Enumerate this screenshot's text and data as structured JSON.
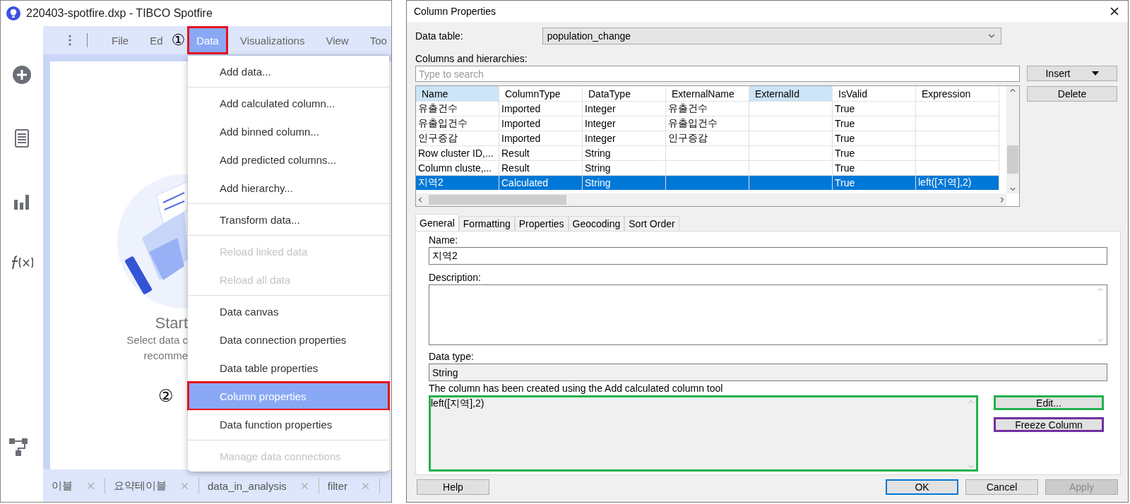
{
  "left_window": {
    "title": "220403-spotfire.dxp - TIBCO Spotfire",
    "menubar": [
      {
        "label": "File",
        "selected": false,
        "highlighted": false
      },
      {
        "label": "Ed",
        "selected": false,
        "highlighted": false
      },
      {
        "label": "Data",
        "selected": true,
        "highlighted": true,
        "marker": "①"
      },
      {
        "label": "Visualizations",
        "selected": false,
        "highlighted": false
      },
      {
        "label": "View",
        "selected": false,
        "highlighted": false
      },
      {
        "label": "Too",
        "selected": false,
        "highlighted": false
      }
    ],
    "start_title": "Start",
    "start_lines": [
      "Select data c",
      "recomme"
    ],
    "menu": {
      "groups": [
        [
          {
            "label": "Add data...",
            "disabled": false,
            "selected": false,
            "highlighted": false
          }
        ],
        [
          {
            "label": "Add calculated column...",
            "disabled": false,
            "selected": false,
            "highlighted": false
          },
          {
            "label": "Add binned column...",
            "disabled": false,
            "selected": false,
            "highlighted": false
          },
          {
            "label": "Add predicted columns...",
            "disabled": false,
            "selected": false,
            "highlighted": false
          },
          {
            "label": "Add hierarchy...",
            "disabled": false,
            "selected": false,
            "highlighted": false
          }
        ],
        [
          {
            "label": "Transform data...",
            "disabled": false,
            "selected": false,
            "highlighted": false
          }
        ],
        [
          {
            "label": "Reload linked data",
            "disabled": true,
            "selected": false,
            "highlighted": false
          },
          {
            "label": "Reload all data",
            "disabled": true,
            "selected": false,
            "highlighted": false
          }
        ],
        [
          {
            "label": "Data canvas",
            "disabled": false,
            "selected": false,
            "highlighted": false
          },
          {
            "label": "Data connection properties",
            "disabled": false,
            "selected": false,
            "highlighted": false
          },
          {
            "label": "Data table properties",
            "disabled": false,
            "selected": false,
            "highlighted": false
          },
          {
            "label": "Column properties",
            "disabled": false,
            "selected": true,
            "highlighted": true,
            "marker": "②"
          },
          {
            "label": "Data function properties",
            "disabled": false,
            "selected": false,
            "highlighted": false
          }
        ],
        [
          {
            "label": "Manage data connections",
            "disabled": true,
            "selected": false,
            "highlighted": false
          }
        ]
      ]
    },
    "bottom_tabs": [
      {
        "label": "이블"
      },
      {
        "label": "요약테이블"
      },
      {
        "label": "data_in_analysis"
      },
      {
        "label": "filter"
      }
    ]
  },
  "dialog": {
    "title": "Column Properties",
    "data_table_label": "Data table:",
    "data_table_value": "population_change",
    "columns_label": "Columns and hierarchies:",
    "search_placeholder": "Type to search",
    "side_buttons": [
      {
        "label": "Insert",
        "dropdown": true
      },
      {
        "label": "Delete",
        "dropdown": false
      }
    ],
    "grid": {
      "columns": [
        {
          "label": "Name",
          "highlighted": true
        },
        {
          "label": "ColumnType",
          "highlighted": false
        },
        {
          "label": "DataType",
          "highlighted": false
        },
        {
          "label": "ExternalName",
          "highlighted": false
        },
        {
          "label": "ExternalId",
          "highlighted": true
        },
        {
          "label": "IsValid",
          "highlighted": false
        },
        {
          "label": "Expression",
          "highlighted": false
        }
      ],
      "rows": [
        {
          "selected": false,
          "cells": [
            "유출건수",
            "Imported",
            "Integer",
            "유출건수",
            "",
            "True",
            ""
          ]
        },
        {
          "selected": false,
          "cells": [
            "유출입건수",
            "Imported",
            "Integer",
            "유출입건수",
            "",
            "True",
            ""
          ]
        },
        {
          "selected": false,
          "cells": [
            "인구증감",
            "Imported",
            "Integer",
            "인구증감",
            "",
            "True",
            ""
          ]
        },
        {
          "selected": false,
          "cells": [
            "Row cluster ID,...",
            "Result",
            "String",
            "",
            "",
            "True",
            ""
          ]
        },
        {
          "selected": false,
          "cells": [
            "Column cluste,...",
            "Result",
            "String",
            "",
            "",
            "True",
            ""
          ]
        },
        {
          "selected": true,
          "cells": [
            "지역2",
            "Calculated",
            "String",
            "",
            "",
            "True",
            "left([지역],2)"
          ]
        }
      ]
    },
    "tabs": [
      {
        "label": "General",
        "selected": true
      },
      {
        "label": "Formatting",
        "selected": false
      },
      {
        "label": "Properties",
        "selected": false
      },
      {
        "label": "Geocoding",
        "selected": false
      },
      {
        "label": "Sort Order",
        "selected": false
      }
    ],
    "name_label": "Name:",
    "name_value": "지역2",
    "description_label": "Description:",
    "data_type_label": "Data type:",
    "data_type_value": "String",
    "expression_caption": "The column has been created using the Add calculated column tool",
    "expression": {
      "value": "left([지역],2)",
      "color": "#22b14c"
    },
    "expression_buttons": [
      {
        "label": "Edit...",
        "color": "#22b14c"
      },
      {
        "label": "Freeze Column",
        "color": "#7030a0"
      }
    ],
    "footer_buttons": [
      {
        "label": "Help",
        "default": false,
        "disabled": false
      },
      {
        "label": "OK",
        "default": true,
        "disabled": false
      },
      {
        "label": "Cancel",
        "default": false,
        "disabled": false
      },
      {
        "label": "Apply",
        "default": false,
        "disabled": true
      }
    ]
  }
}
